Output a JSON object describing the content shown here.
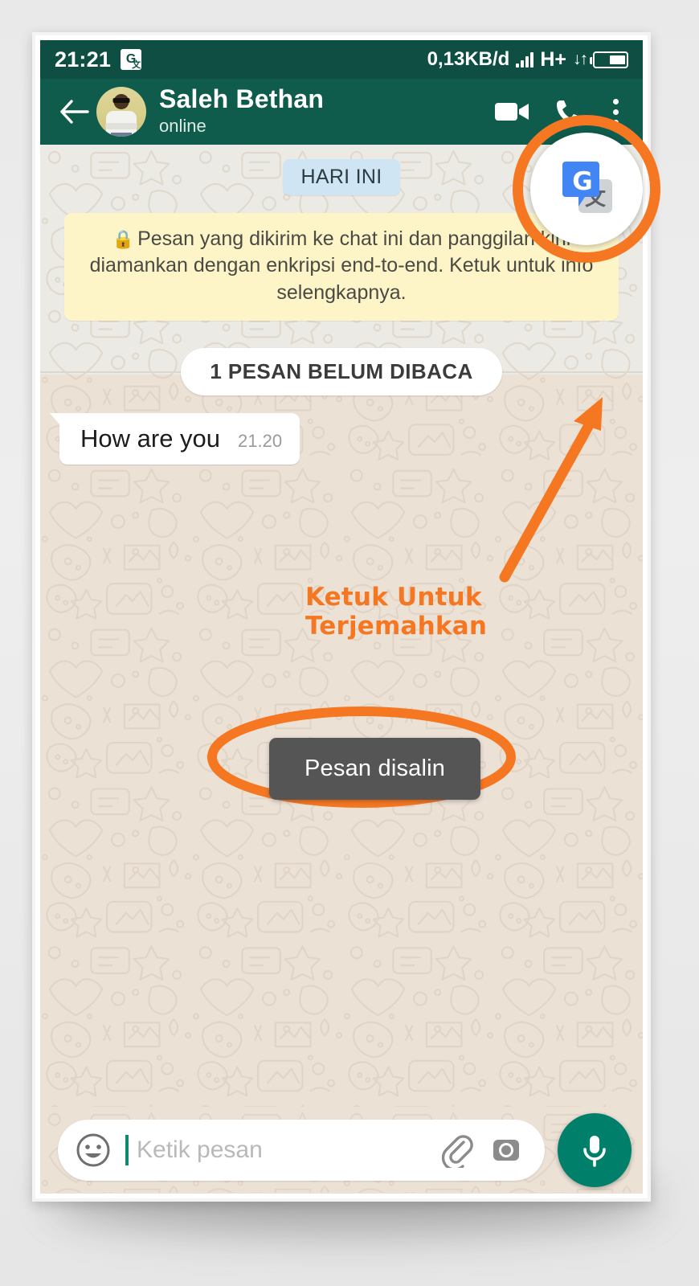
{
  "status_bar": {
    "time": "21:21",
    "translate_icon": "google-translate-icon",
    "data_rate": "0,13KB/d",
    "signal_icon": "signal-bars-icon",
    "network_type": "H+",
    "data_arrows": "↓↑",
    "battery_icon": "battery-icon"
  },
  "app_bar": {
    "back_icon": "back-arrow-icon",
    "avatar": "contact-avatar",
    "contact_name": "Saleh Bethan",
    "presence": "online",
    "video_call_icon": "video-call-icon",
    "voice_call_icon": "phone-call-icon",
    "overflow_icon": "overflow-menu-icon"
  },
  "chat": {
    "date_chip": "HARI INI",
    "encryption_notice": "Pesan yang dikirim ke chat ini dan panggilan kini diamankan dengan enkripsi end-to-end. Ketuk untuk info selengkapnya.",
    "lock_icon": "lock-icon",
    "unread_divider": "1 PESAN BELUM DIBACA",
    "messages": [
      {
        "text": "How are you",
        "time": "21.20",
        "direction": "incoming"
      }
    ]
  },
  "annotations": {
    "tap_to_translate": "Ketuk Untuk Terjemahkan",
    "arrow_icon": "orange-arrow-icon",
    "highlight_ellipse_icon": "orange-ellipse-highlight-icon",
    "highlight_ring_icon": "orange-ring-highlight-icon",
    "accent_color": "#f57722"
  },
  "translate_bubble": {
    "icon": "google-translate-floating-bubble",
    "letter": "G",
    "target_glyph": "文"
  },
  "toast": {
    "message": "Pesan disalin"
  },
  "input_bar": {
    "emoji_icon": "emoji-icon",
    "placeholder": "Ketik pesan",
    "value": "",
    "attach_icon": "attachment-paperclip-icon",
    "camera_icon": "camera-icon",
    "mic_icon": "microphone-icon"
  },
  "colors": {
    "status_bar": "#0f4f43",
    "app_bar": "#0f5c4c",
    "accent_orange": "#f57722",
    "fab_teal": "#00806a",
    "chat_bg": "#ece1d5",
    "notice_yellow": "#fdf4c7",
    "date_chip_blue": "#cfe5f3",
    "toast_grey": "#555555"
  }
}
